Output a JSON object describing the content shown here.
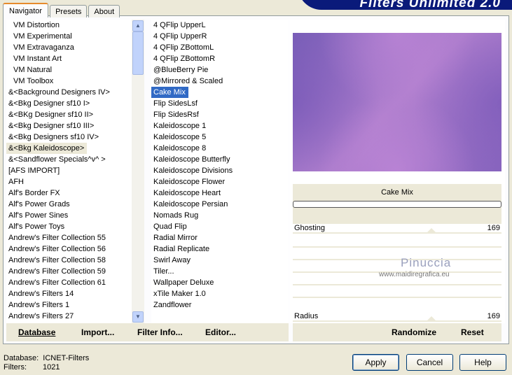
{
  "tabs": [
    "Navigator",
    "Presets",
    "About"
  ],
  "banner": "Filters Unlimited 2.0",
  "categories": [
    "VM Distortion",
    "VM Experimental",
    "VM Extravaganza",
    "VM Instant Art",
    "VM Natural",
    "VM Toolbox",
    "&<Background Designers IV>",
    "&<Bkg Designer sf10 I>",
    "&<BKg Designer sf10 II>",
    "&<Bkg Designer sf10 III>",
    "&<Bkg Designers sf10 IV>",
    "&<Bkg Kaleidoscope>",
    "&<Sandflower Specials^v^ >",
    "[AFS IMPORT]",
    "AFH",
    "Alf's Border FX",
    "Alf's Power Grads",
    "Alf's Power Sines",
    "Alf's Power Toys",
    "Andrew's Filter Collection 55",
    "Andrew's Filter Collection 56",
    "Andrew's Filter Collection 58",
    "Andrew's Filter Collection 59",
    "Andrew's Filter Collection 61",
    "Andrew's Filters 14",
    "Andrew's Filters 1",
    "Andrew's Filters 27"
  ],
  "selected_category_index": 11,
  "filters": [
    "4 QFlip UpperL",
    "4 QFlip UpperR",
    "4 QFlip ZBottomL",
    "4 QFlip ZBottomR",
    "@BlueBerry Pie",
    "@Mirrored & Scaled",
    "Cake Mix",
    "Flip SidesLsf",
    "Flip SidesRsf",
    "Kaleidoscope 1",
    "Kaleidoscope 5",
    "Kaleidoscope 8",
    "Kaleidoscope Butterfly",
    "Kaleidoscope Divisions",
    "Kaleidoscope Flower",
    "Kaleidoscope Heart",
    "Kaleidoscope Persian",
    "Nomads Rug",
    "Quad Flip",
    "Radial Mirror",
    "Radial Replicate",
    "Swirl Away",
    "Tiler...",
    "Wallpaper Deluxe",
    "xTile Maker 1.0",
    "Zandflower"
  ],
  "selected_filter_index": 6,
  "filter_name": "Cake Mix",
  "progress": 0,
  "sliders": [
    {
      "label": "Ghosting",
      "value": "169"
    },
    {
      "label": "Radius",
      "value": "169"
    }
  ],
  "watermark": {
    "name": "Pinuccia",
    "url": "www.maidiregrafica.eu"
  },
  "toolbar": {
    "database": "Database",
    "import": "Import...",
    "filter_info": "Filter Info...",
    "editor": "Editor...",
    "randomize": "Randomize",
    "reset": "Reset"
  },
  "status": {
    "database_label": "Database:",
    "database_value": "ICNET-Filters",
    "filters_label": "Filters:",
    "filters_value": "1021"
  },
  "buttons": {
    "apply": "Apply",
    "cancel": "Cancel",
    "help": "Help"
  }
}
